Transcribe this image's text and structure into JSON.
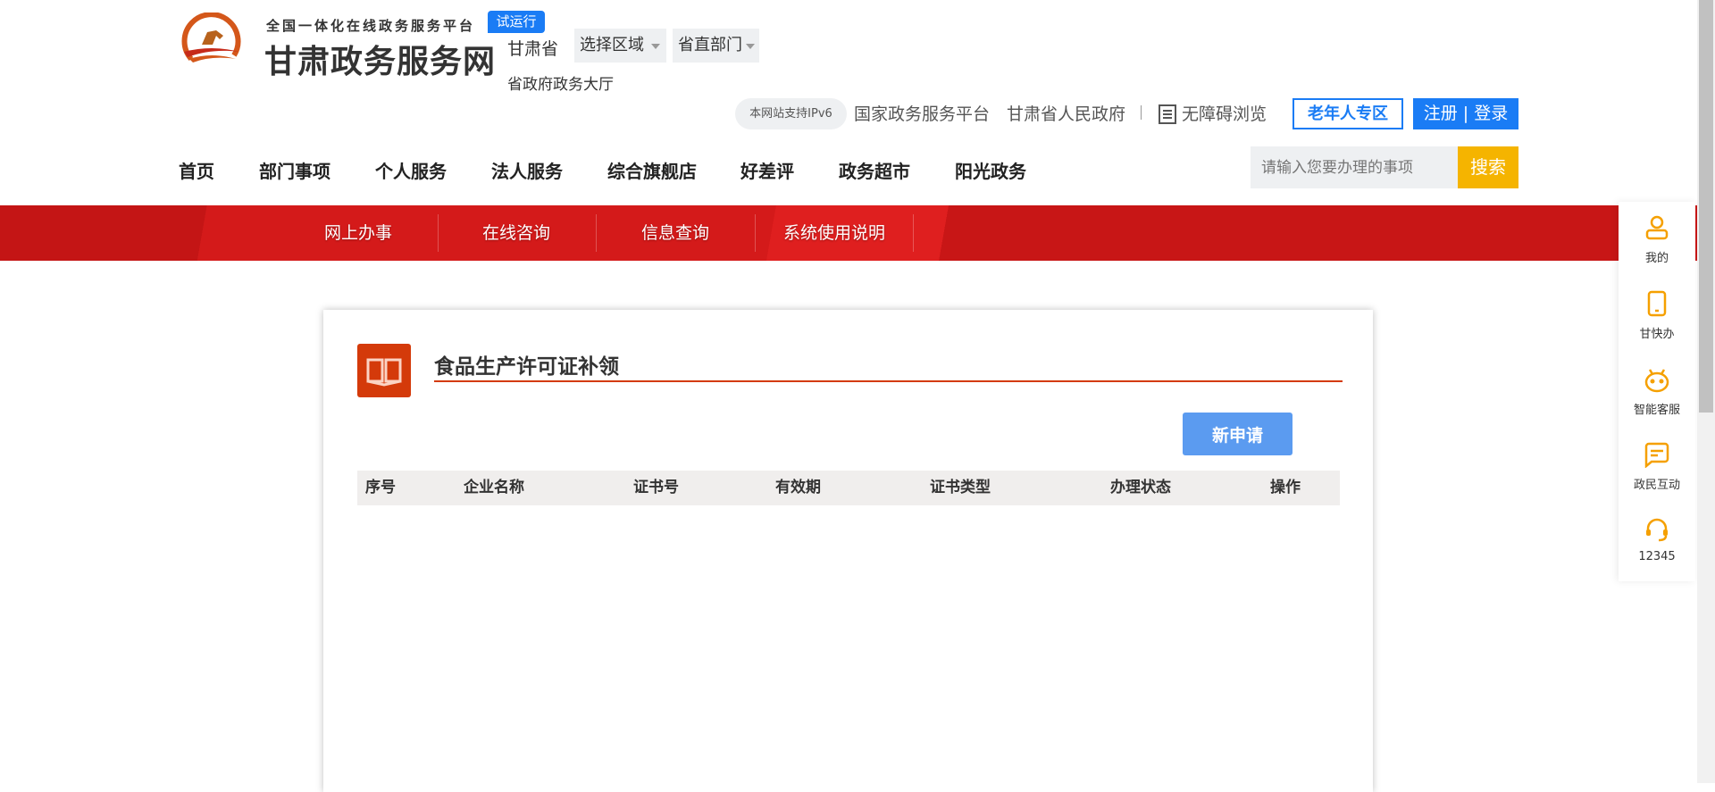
{
  "header": {
    "logo_subtitle": "全国一体化在线政务服务平台",
    "logo_title": "甘肃政务服务网",
    "trial_badge": "试运行",
    "province": "甘肃省",
    "region_select": "选择区域",
    "dept_select": "省直部门",
    "hall": "省政府政务大厅",
    "ipv6": "本网站支持IPv6",
    "link_national": "国家政务服务平台",
    "link_gov": "甘肃省人民政府",
    "accessibility": "无障碍浏览",
    "elder": "老年人专区",
    "register": "注册",
    "login": "登录"
  },
  "nav": [
    "首页",
    "部门事项",
    "个人服务",
    "法人服务",
    "综合旗舰店",
    "好差评",
    "政务超市",
    "阳光政务"
  ],
  "search": {
    "placeholder": "请输入您要办理的事项",
    "button": "搜索"
  },
  "subnav": [
    "网上办事",
    "在线咨询",
    "信息查询",
    "系统使用说明"
  ],
  "main": {
    "title": "食品生产许可证补领",
    "new_button": "新申请",
    "columns": [
      "序号",
      "企业名称",
      "证书号",
      "有效期",
      "证书类型",
      "办理状态",
      "操作"
    ]
  },
  "sidebar": [
    "我的",
    "甘快办",
    "智能客服",
    "政民互动",
    "12345"
  ],
  "colors": {
    "brand_red": "#d41a1a",
    "blue": "#1a7cf5",
    "orange": "#f5a000",
    "title_red": "#d43a0a"
  }
}
